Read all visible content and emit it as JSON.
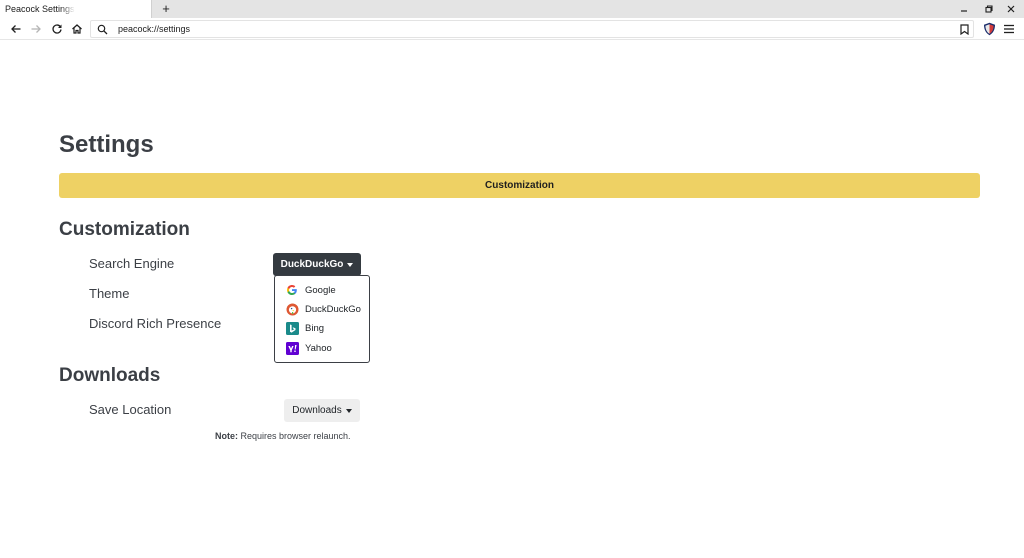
{
  "browser": {
    "tab_title": "Peacock Settings",
    "new_tab_label": "+",
    "url": "peacock://settings",
    "icons": {
      "back": "arrow-left-icon",
      "forward": "arrow-right-icon",
      "reload": "reload-icon",
      "home": "home-icon",
      "search": "search-icon",
      "bookmark": "bookmark-icon",
      "shield": "shield-icon",
      "menu": "hamburger-menu-icon"
    }
  },
  "page": {
    "title": "Settings",
    "section_bar": "Customization"
  },
  "customization": {
    "heading": "Customization",
    "search_engine_label": "Search Engine",
    "theme_label": "Theme",
    "discord_label": "Discord Rich Presence",
    "search_engine_selected": "DuckDuckGo",
    "engines": [
      {
        "label": "Google",
        "icon": "google-icon"
      },
      {
        "label": "DuckDuckGo",
        "icon": "duckduckgo-icon"
      },
      {
        "label": "Bing",
        "icon": "bing-icon"
      },
      {
        "label": "Yahoo",
        "icon": "yahoo-icon"
      }
    ]
  },
  "downloads": {
    "heading": "Downloads",
    "save_location_label": "Save Location",
    "button_label": "Downloads",
    "note_prefix": "Note:",
    "note_text": " Requires browser relaunch."
  },
  "colors": {
    "accent_bar": "#eed164",
    "dark_button": "#343a40",
    "text": "#3b3f45"
  }
}
